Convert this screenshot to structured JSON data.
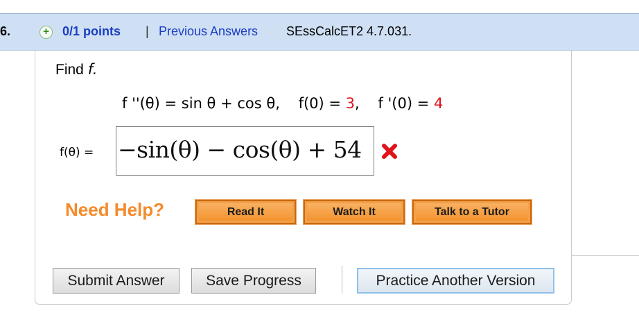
{
  "header": {
    "question_number": "6.",
    "points": "0/1 points",
    "separator": "|",
    "previous_answers": "Previous Answers",
    "reference": "SEssCalcET2 4.7.031."
  },
  "question": {
    "prompt_word": "Find ",
    "prompt_var": "f.",
    "equation_part1": "f ''(θ) = sin θ + cos θ,    f(0) = ",
    "condition_value_1": "3",
    "equation_part2": ",    f '(0) = ",
    "condition_value_2": "4"
  },
  "answer": {
    "label": "f(θ) =",
    "value": "−sin(θ) − cos(θ) + 54",
    "status": "incorrect"
  },
  "help": {
    "label": "Need Help?",
    "buttons": [
      "Read It",
      "Watch It",
      "Talk to a Tutor"
    ]
  },
  "actions": {
    "submit": "Submit Answer",
    "save": "Save Progress",
    "practice": "Practice Another Version"
  },
  "colors": {
    "header_bg": "#cfe0f5",
    "link_blue": "#1b3ec2",
    "highlight_red": "#e0121a",
    "help_orange": "#f58a2a"
  },
  "icons": {
    "points_icon": "plus-icon",
    "status_icon": "red-x-icon"
  }
}
